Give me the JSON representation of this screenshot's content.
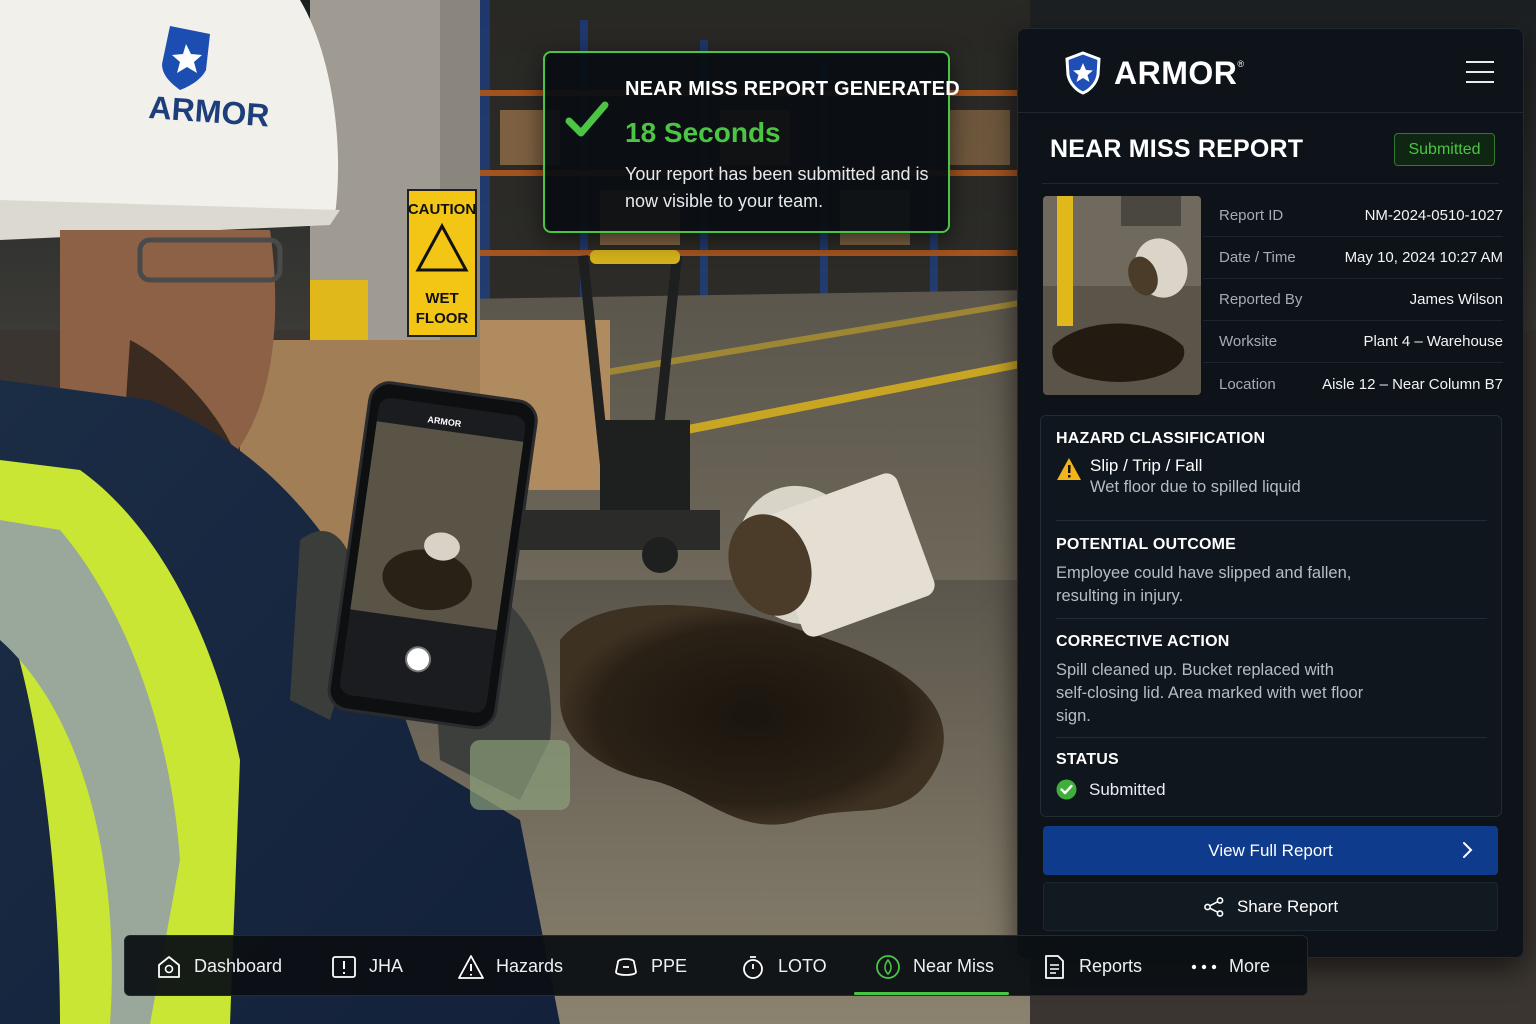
{
  "helmet": {
    "brand": "ARMOR"
  },
  "sign": {
    "header": "CAUTION",
    "line1": "WET",
    "line2": "FLOOR"
  },
  "phone": {
    "brand": "ARMOR"
  },
  "toast": {
    "title": "NEAR MISS REPORT GENERATED",
    "time": "18 Seconds",
    "message": "Your report has been submitted and is now visible to your team."
  },
  "panel": {
    "brand": "ARMOR",
    "brand_mark": "®",
    "title": "NEAR MISS REPORT",
    "badge": "Submitted",
    "meta": [
      {
        "key": "Report ID",
        "value": "NM-2024-0510-1027"
      },
      {
        "key": "Date / Time",
        "value": "May 10, 2024  10:27 AM"
      },
      {
        "key": "Reported By",
        "value": "James Wilson"
      },
      {
        "key": "Worksite",
        "value": "Plant 4 – Warehouse"
      },
      {
        "key": "Location",
        "value": "Aisle 12 – Near Column B7"
      }
    ],
    "hazard": {
      "heading": "HAZARD CLASSIFICATION",
      "type": "Slip / Trip / Fall",
      "detail": "Wet floor due to spilled liquid"
    },
    "outcome": {
      "heading": "POTENTIAL OUTCOME",
      "text": "Employee could have slipped and fallen, resulting in injury."
    },
    "action": {
      "heading": "CORRECTIVE ACTION",
      "text": "Spill cleaned up. Bucket replaced with self-closing lid. Area marked with wet floor sign."
    },
    "status": {
      "heading": "STATUS",
      "value": "Submitted"
    },
    "view_button": "View Full Report",
    "share_button": "Share Report"
  },
  "nav": {
    "active": "Near Miss",
    "accent_color": "#49c545",
    "items": [
      {
        "label": "Dashboard",
        "icon": "dashboard-icon"
      },
      {
        "label": "JHA",
        "icon": "jha-icon"
      },
      {
        "label": "Hazards",
        "icon": "hazard-triangle-icon"
      },
      {
        "label": "PPE",
        "icon": "ppe-icon"
      },
      {
        "label": "LOTO",
        "icon": "lock-timer-icon"
      },
      {
        "label": "Near Miss",
        "icon": "near-miss-icon"
      },
      {
        "label": "Reports",
        "icon": "report-document-icon"
      },
      {
        "label": "More",
        "icon": "more-dots-icon"
      }
    ]
  }
}
